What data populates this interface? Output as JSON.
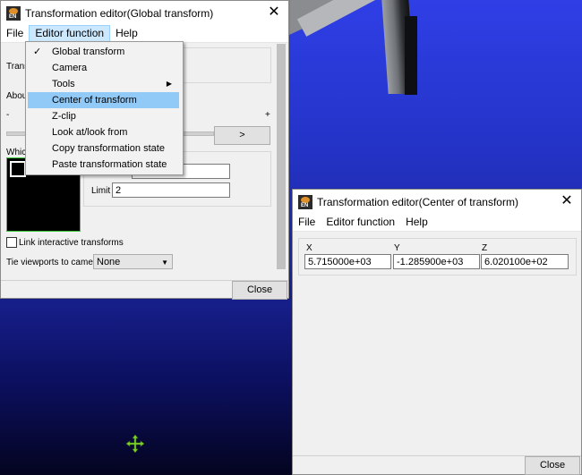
{
  "win1": {
    "title": "Transformation editor(Global transform)",
    "menus": [
      "File",
      "Editor function",
      "Help"
    ],
    "transform_label": "Transf",
    "about_label": "About",
    "minus_label": "-",
    "plus_label": "+",
    "next_button": ">",
    "which_label": "Which",
    "limit_label": "Limit",
    "limit_value": "2",
    "link_label": "Link interactive transforms",
    "tie_label": "Tie viewports to camera",
    "tie_value": "None",
    "close_label": "Close"
  },
  "dropdown": {
    "items": [
      {
        "label": "Global transform",
        "checked": true
      },
      {
        "label": "Camera"
      },
      {
        "label": "Tools",
        "submenu": true
      },
      {
        "label": "Center of transform",
        "highlighted": true
      },
      {
        "label": "Z-clip"
      },
      {
        "label": "Look at/look from"
      },
      {
        "label": "Copy transformation state"
      },
      {
        "label": "Paste transformation state"
      }
    ]
  },
  "win2": {
    "title": "Transformation editor(Center of transform)",
    "menus": [
      "File",
      "Editor function",
      "Help"
    ],
    "x_label": "X",
    "y_label": "Y",
    "z_label": "Z",
    "x_value": "5.715000e+03",
    "y_value": "-1.285900e+03",
    "z_value": "6.020100e+02",
    "close_label": "Close"
  },
  "icons": {
    "app_icon_text": "EN"
  }
}
